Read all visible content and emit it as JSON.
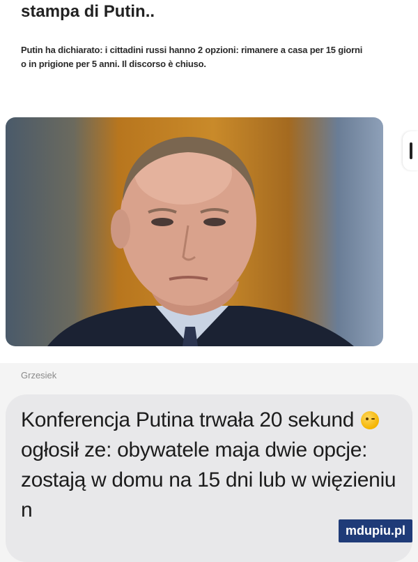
{
  "shared_post": {
    "title": "stampa di Putin..",
    "body": "Putin ha dichiarato: i cittadini russi hanno 2 opzioni: rimanere a casa per 15 giorni o in prigione per 5 anni. Il discorso è chiuso."
  },
  "chat": {
    "sender": "Grzesiek",
    "message_part1": "Konferencja Putina trwała 20 sekund",
    "emoji_icon": "wink-emoji-icon",
    "message_part2": "ogłosił ze: obywatele maja dwie opcje: zostają w domu na 15 dni lub w więzieniu n"
  },
  "watermark": {
    "text": "mdupiu.pl"
  },
  "colors": {
    "bubble": "#e8e8ea",
    "watermark_bg": "#1f3b78"
  }
}
